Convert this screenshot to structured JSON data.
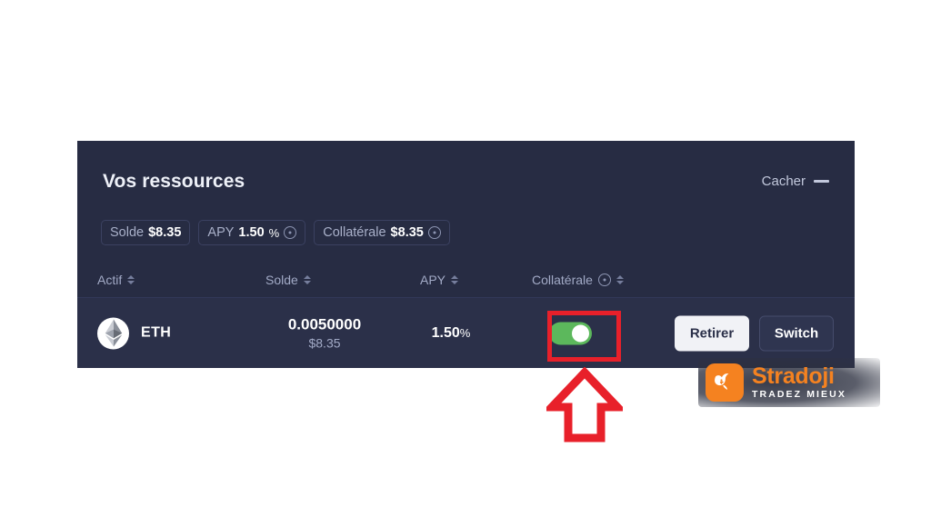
{
  "panel": {
    "title": "Vos ressources",
    "hide": {
      "label": "Cacher",
      "icon": "minus-dash-icon"
    },
    "summary_pills": [
      {
        "label": "Solde",
        "currency": "$",
        "value": "8.35",
        "unit": "",
        "has_info": false
      },
      {
        "label": "APY",
        "currency": "",
        "value": "1.50",
        "unit": "%",
        "has_info": true
      },
      {
        "label": "Collatérale",
        "currency": "$",
        "value": "8.35",
        "unit": "",
        "has_info": true
      }
    ],
    "table": {
      "columns": [
        {
          "label": "Actif",
          "sortable": true,
          "has_info": false
        },
        {
          "label": "Solde",
          "sortable": true,
          "has_info": false
        },
        {
          "label": "APY",
          "sortable": true,
          "has_info": false
        },
        {
          "label": "Collatérale",
          "sortable": true,
          "has_info": true
        }
      ],
      "rows": [
        {
          "asset_icon": "ethereum-icon",
          "asset_symbol": "ETH",
          "balance_amount": "0.0050000",
          "balance_currency": "$",
          "balance_usd": "8.35",
          "apy_value": "1.50",
          "apy_unit": "%",
          "collateral_enabled": true,
          "withdraw_label": "Retirer",
          "switch_label": "Switch"
        }
      ]
    }
  },
  "annotations": {
    "highlight_color": "#e8202a",
    "highlight_target": "collateral-toggle",
    "arrow_direction": "up"
  },
  "watermark": {
    "brand_name": "Stradoji",
    "tagline": "TRADEZ MIEUX",
    "brand_color": "#f58220"
  }
}
